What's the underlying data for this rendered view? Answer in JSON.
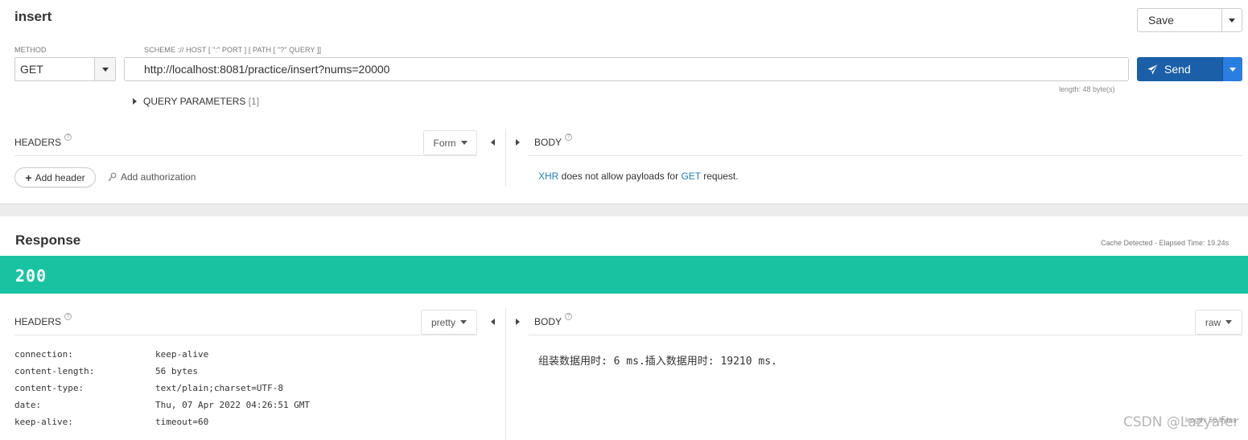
{
  "request": {
    "title": "insert",
    "save_label": "Save",
    "method_label": "METHOD",
    "method_value": "GET",
    "url_label": "SCHEME :// HOST [ \":\" PORT ] [ PATH [ \"?\" QUERY ]]",
    "url_value": "http://localhost:8081/practice/insert?nums=20000",
    "url_length": "length: 48 byte(s)",
    "send_label": "Send",
    "query_params_label": "QUERY PARAMETERS",
    "query_params_count": "[1]",
    "headers_label": "HEADERS",
    "headers_mode": "Form",
    "body_label": "BODY",
    "add_header_label": "Add header",
    "add_auth_label": "Add authorization",
    "body_msg": {
      "xhr": "XHR",
      "mid": " does not allow payloads for ",
      "get": "GET",
      "end": " request."
    }
  },
  "response": {
    "title": "Response",
    "cache_info": "Cache Detected - Elapsed Time: 19.24s",
    "status_code": "200",
    "headers_label": "HEADERS",
    "headers_mode": "pretty",
    "body_label": "BODY",
    "body_mode": "raw",
    "headers": [
      {
        "key": "connection:",
        "value": "keep-alive"
      },
      {
        "key": "content-length:",
        "value": "56 bytes"
      },
      {
        "key": "content-type:",
        "value": "text/plain;charset=UTF-8"
      },
      {
        "key": "date:",
        "value": "Thu, 07 Apr 2022 04:26:51 GMT"
      },
      {
        "key": "keep-alive:",
        "value": "timeout=60"
      }
    ],
    "body_text": "组装数据用时: 6 ms.插入数据用时: 19210 ms.",
    "body_length": "length: 56 bytes"
  },
  "watermark": "CSDN @Lazyafer",
  "colors": {
    "status_bar": "#19c3a2",
    "send_button": "#1a5fa8",
    "link_blue": "#1f7fc1"
  },
  "icons": {
    "help": "help-circle-icon",
    "send": "paper-plane-icon",
    "key": "key-icon",
    "plus": "plus-icon"
  }
}
